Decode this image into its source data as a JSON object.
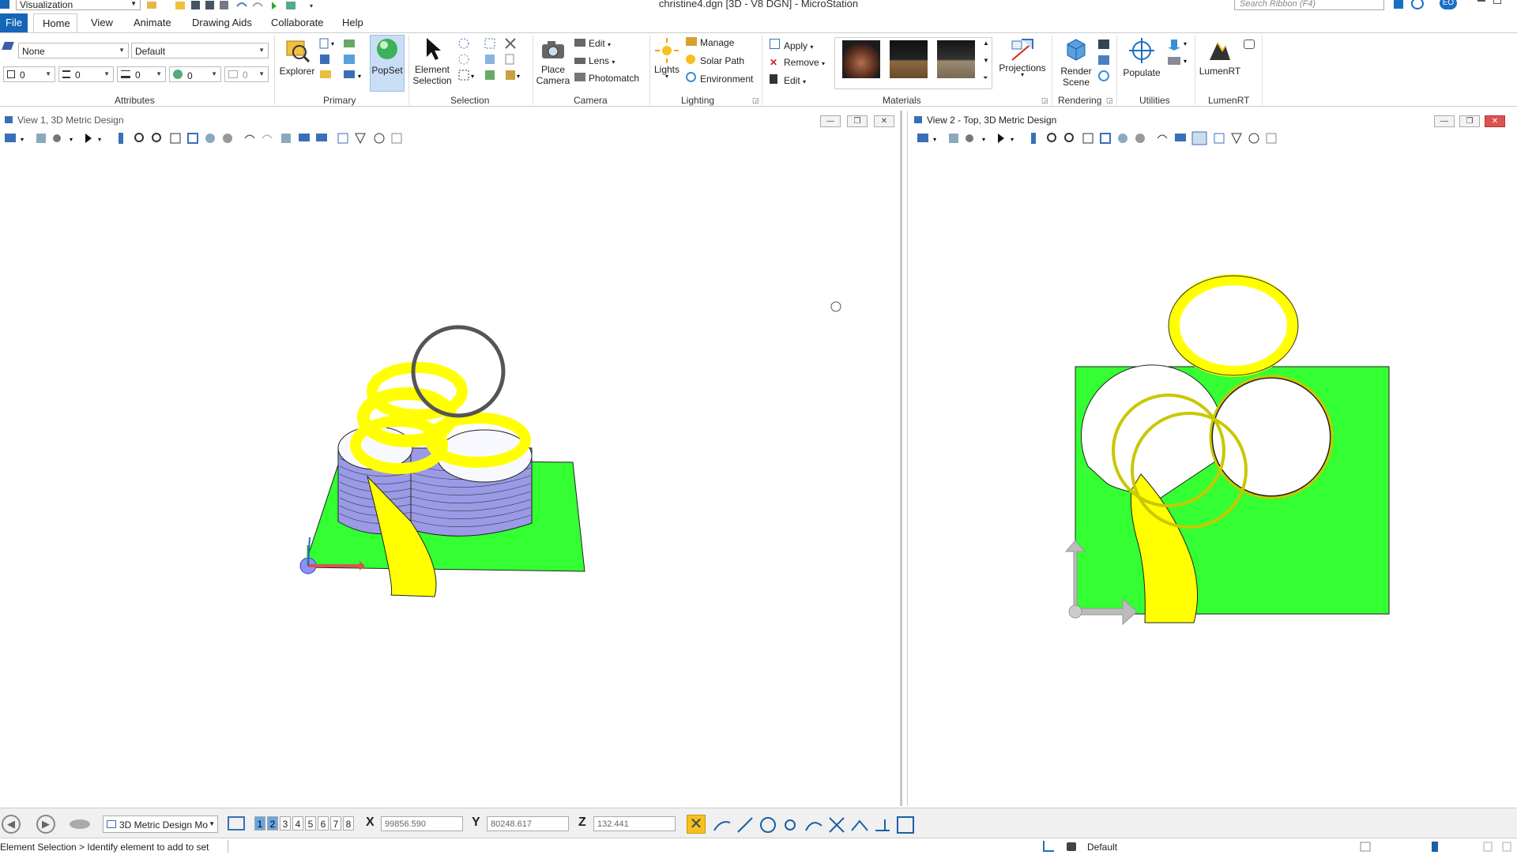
{
  "window": {
    "title": "christine4.dgn [3D - V8 DGN] - MicroStation",
    "workflow": "Visualization",
    "search_placeholder": "Search Ribbon (F4)",
    "user_badge": "EO"
  },
  "menu": {
    "tabs": [
      {
        "label": "File"
      },
      {
        "label": "Home"
      },
      {
        "label": "View"
      },
      {
        "label": "Animate"
      },
      {
        "label": "Drawing Aids"
      },
      {
        "label": "Collaborate"
      },
      {
        "label": "Help"
      }
    ]
  },
  "ribbon": {
    "attributes": {
      "label": "Attributes",
      "level": "None",
      "style": "Default",
      "color": "0",
      "weight": "0",
      "linestyle": "0",
      "transparency": "0",
      "priority": "0"
    },
    "primary": {
      "label": "Primary",
      "explorer": "Explorer",
      "popset": "PopSet"
    },
    "selection": {
      "label": "Selection",
      "element_selection_1": "Element",
      "element_selection_2": "Selection"
    },
    "camera": {
      "label": "Camera",
      "place_camera_1": "Place",
      "place_camera_2": "Camera",
      "edit": "Edit",
      "lens": "Lens",
      "photomatch": "Photomatch"
    },
    "lighting": {
      "label": "Lighting",
      "lights": "Lights",
      "manage": "Manage",
      "solar_path": "Solar Path",
      "environment": "Environment"
    },
    "materials_tools": {
      "apply": "Apply",
      "remove": "Remove",
      "edit": "Edit"
    },
    "materials": {
      "label": "Materials"
    },
    "projections": {
      "label": "Projections"
    },
    "rendering": {
      "label": "Rendering",
      "render_scene_1": "Render",
      "render_scene_2": "Scene"
    },
    "utilities": {
      "label": "Utilities",
      "populate": "Populate"
    },
    "lumenrt": {
      "label": "LumenRT",
      "button": "LumenRT"
    }
  },
  "views": {
    "view1": {
      "title": "View 1, 3D Metric Design"
    },
    "view2": {
      "title": "View 2 - Top, 3D Metric Design"
    }
  },
  "bottom": {
    "model": "3D Metric Design Mo",
    "view_numbers": [
      "1",
      "2",
      "3",
      "4",
      "5",
      "6",
      "7",
      "8"
    ],
    "active_views": [
      "1",
      "2"
    ],
    "x_label": "X",
    "x_value": "99856.590",
    "y_label": "Y",
    "y_value": "80248.617",
    "z_label": "Z",
    "z_value": "132.441"
  },
  "status": {
    "prompt": "Element Selection > Identify element to add to set",
    "level": "Default"
  },
  "colors": {
    "accent": "#1566b7",
    "ground": "#33ff33",
    "ribbon_yellow": "#ffff00",
    "building_blue": "#9a9ae6"
  }
}
